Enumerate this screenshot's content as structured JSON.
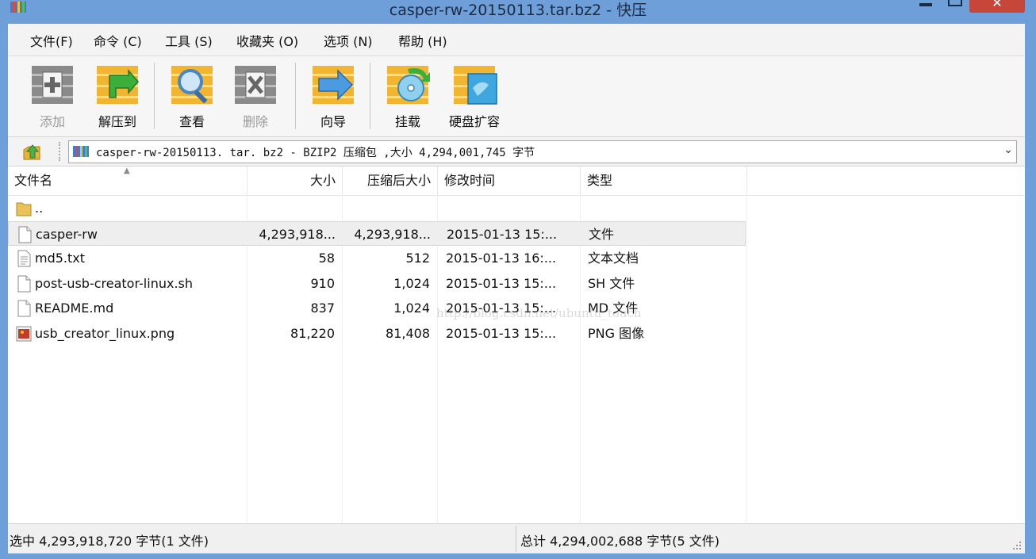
{
  "window": {
    "title": "casper-rw-20150113.tar.bz2 - 快压",
    "close_glyph": "✕"
  },
  "menu": [
    {
      "label": "文件(F)"
    },
    {
      "label": "命令 (C)"
    },
    {
      "label": "工具 (S)"
    },
    {
      "label": "收藏夹 (O)"
    },
    {
      "label": "选项 (N)"
    },
    {
      "label": "帮助 (H)"
    }
  ],
  "toolbar": {
    "add": "添加",
    "extract": "解压到",
    "view": "查看",
    "delete": "删除",
    "wizard": "向导",
    "mount": "挂载",
    "disk_expand": "硬盘扩容"
  },
  "address": {
    "text": "casper-rw-20150113. tar. bz2 - BZIP2 压缩包 ,大小 4,294,001,745 字节",
    "dropdown_glyph": "⌄"
  },
  "columns": {
    "name": "文件名",
    "size": "大小",
    "packed": "压缩后大小",
    "modified": "修改时间",
    "type": "类型"
  },
  "files": [
    {
      "name": "..",
      "size": "",
      "packed": "",
      "modified": "",
      "type": "",
      "icon": "folder-icon"
    },
    {
      "name": "casper-rw",
      "size": "4,293,918...",
      "packed": "4,293,918...",
      "modified": "2015-01-13   15:...",
      "type": "文件",
      "icon": "file-icon"
    },
    {
      "name": "md5.txt",
      "size": "58",
      "packed": "512",
      "modified": "2015-01-13   16:...",
      "type": "文本文档",
      "icon": "text-file-icon"
    },
    {
      "name": "post-usb-creator-linux.sh",
      "size": "910",
      "packed": "1,024",
      "modified": "2015-01-13   15:...",
      "type": "SH 文件",
      "icon": "file-icon"
    },
    {
      "name": "README.md",
      "size": "837",
      "packed": "1,024",
      "modified": "2015-01-13   15:...",
      "type": "MD 文件",
      "icon": "file-icon"
    },
    {
      "name": "usb_creator_linux.png",
      "size": "81,220",
      "packed": "81,408",
      "modified": "2015-01-13   15:...",
      "type": "PNG 图像",
      "icon": "image-file-icon"
    }
  ],
  "status": {
    "selected": "选中  4,293,918,720 字节(1 文件)",
    "total": "总计  4,294,002,688 字节(5 文件)"
  },
  "watermark": "http://blog.csdn.net/ubuntu_touch",
  "colors": {
    "window_frame": "#6f9fd8",
    "close_button": "#c7463a",
    "toolbar_icon_yellow": "#f2b531",
    "toolbar_icon_gray": "#7c7c7c"
  }
}
